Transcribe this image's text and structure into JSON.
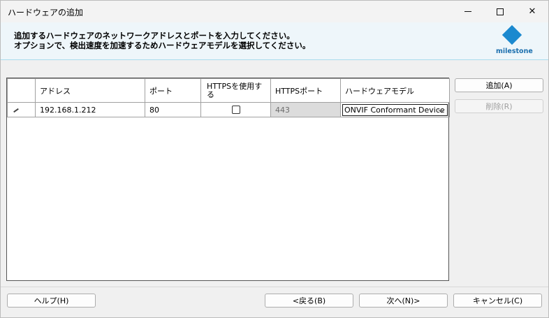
{
  "window": {
    "title": "ハードウェアの追加"
  },
  "header": {
    "line1": "追加するハードウェアのネットワークアドレスとポートを入力してください。",
    "line2": "オプションで、検出速度を加速するためハードウェアモデルを選択してください。",
    "logo_text": "milestone",
    "accent": "#1b89cf"
  },
  "grid": {
    "columns": {
      "address": "アドレス",
      "port": "ポート",
      "https": "HTTPSを使用する",
      "https_port": "HTTPSポート",
      "model": "ハードウェアモデル"
    },
    "rows": [
      {
        "address": "192.168.1.212",
        "port": "80",
        "https_checked": false,
        "https_port": "443",
        "model": "ONVIF Conformant Device"
      }
    ]
  },
  "buttons": {
    "add": "追加(A)",
    "delete": "削除(R)",
    "help": "ヘルプ(H)",
    "back": "<戻る(B)",
    "next": "次へ(N)>",
    "cancel": "キャンセル(C)"
  }
}
